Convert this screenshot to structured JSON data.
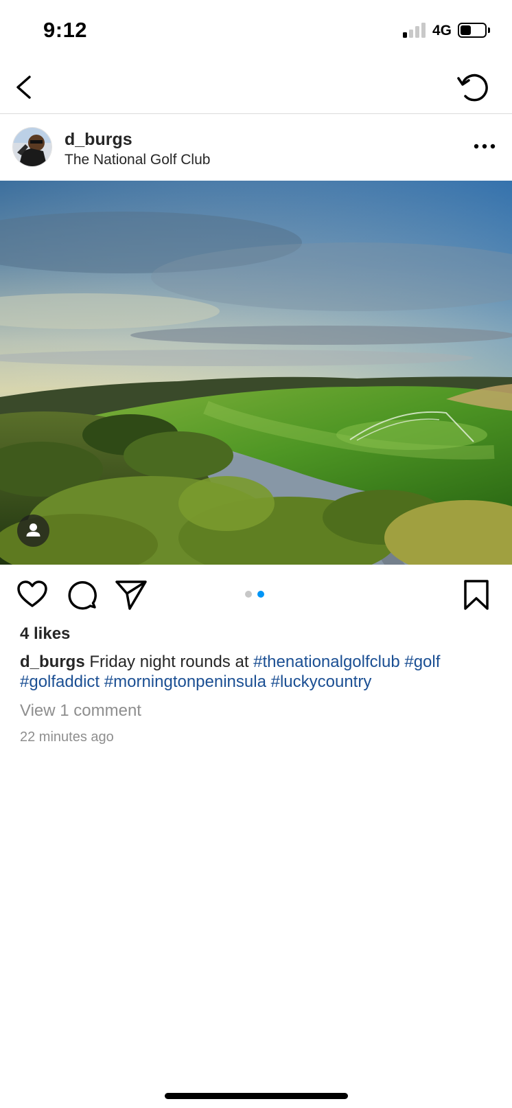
{
  "status_bar": {
    "time": "9:12",
    "network": "4G",
    "signal_bars_active": 1,
    "signal_bars_total": 4,
    "battery_level": 0.45
  },
  "nav": {
    "back_icon": "chevron-left-icon",
    "refresh_icon": "refresh-icon"
  },
  "post": {
    "username": "d_burgs",
    "location": "The National Golf Club",
    "more_icon": "ellipsis-icon",
    "image_icon": "user-tag-icon",
    "carousel_index": 2,
    "carousel_total": 2,
    "likes": "4 likes",
    "caption": {
      "username": "d_burgs",
      "text": "Friday night rounds at",
      "hashtags": [
        "#thenationalgolfclub",
        "#golf",
        "#golfaddict",
        "#morningtonpeninsula",
        "#luckycountry"
      ]
    },
    "view_comments": "View 1 comment",
    "timestamp": "22 minutes ago"
  },
  "colors": {
    "text": "#262626",
    "muted": "#8e8e8e",
    "hashtag": "#1b4f93",
    "carousel_active": "#0095f6",
    "carousel_inactive": "#c7c7c7",
    "divider": "#dbdbdb"
  }
}
